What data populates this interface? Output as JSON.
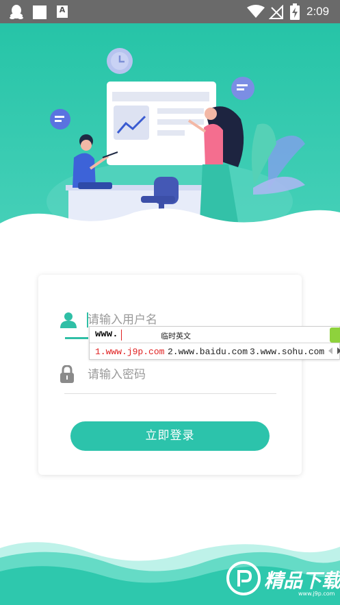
{
  "status_bar": {
    "time": "2:09",
    "icons": [
      "qq-icon",
      "square-notification-icon",
      "font-a-icon",
      "wifi-icon",
      "no-signal-icon",
      "battery-charging-icon"
    ],
    "font_icon_letter": "A"
  },
  "colors": {
    "accent": "#2cc3ab",
    "status_bar": "#6a6a6a",
    "placeholder": "#9a9a9a"
  },
  "login": {
    "username_placeholder": "请输入用户名",
    "password_placeholder": "请输入密码",
    "submit_label": "立即登录"
  },
  "ime": {
    "composing": "www.",
    "mode": "临时英文",
    "candidates": [
      "1.www.j9p.com",
      "2.www.baidu.com",
      "3.www.sohu.com"
    ]
  },
  "watermark": {
    "brand": "精品下载",
    "url": "www.j9p.com"
  }
}
